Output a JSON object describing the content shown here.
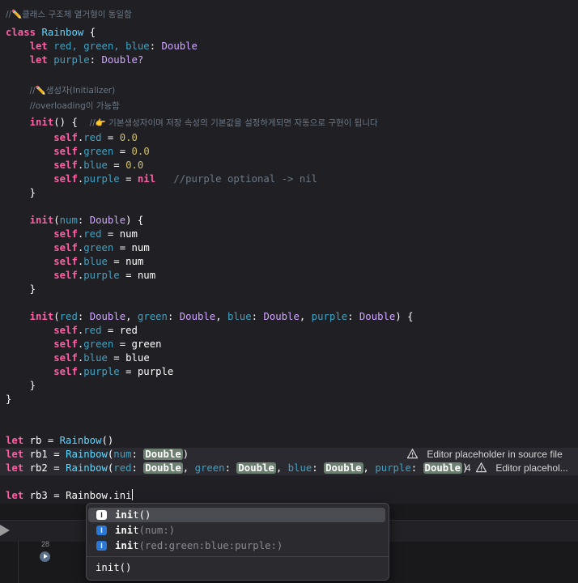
{
  "code": {
    "l1": "//✏️클래스 구조체 열거형이 동일함",
    "l2_kw": "class",
    "l2_name": "Rainbow",
    "l2_brace": " {",
    "l3_kw": "let",
    "l3_vars": "red, green, blue",
    "l3_type": "Double",
    "l4_kw": "let",
    "l4_var": "purple",
    "l4_type": "Double?",
    "l6": "//✏️생성자(Initializer)",
    "l7": "//overloading이 가능함",
    "l8_kw": "init",
    "l8_sig": "() {  ",
    "l8_cm": "//👉 기본생성자이며 저장 속성의 기본값을 설정하게되면 자동으로 구현이 됩니다",
    "self": "self",
    "red": "red",
    "green": "green",
    "blue": "blue",
    "purple": "purple",
    "zero": "0.0",
    "nil": "nil",
    "purple_cm": "//purple optional -> nil",
    "num": "num",
    "Double": "Double",
    "let": "let",
    "init": "init",
    "rb": "rb",
    "rb1": "rb1",
    "rb2": "rb2",
    "rb3": "rb3",
    "Rainbow": "Rainbow",
    "typed": "Rainbow.ini"
  },
  "warnings": {
    "w1": "Editor placeholder in source file",
    "w2_count": "4",
    "w2": "Editor placehol..."
  },
  "debug": {
    "line_number": "28"
  },
  "autocomplete": {
    "badge": "I",
    "items": [
      {
        "match": "ini",
        "rest": "t()",
        "params": ""
      },
      {
        "match": "ini",
        "rest": "t",
        "params": "(num:)"
      },
      {
        "match": "ini",
        "rest": "t",
        "params": "(red:green:blue:purple:)"
      }
    ],
    "detail": "init()"
  },
  "colors": {
    "background": "#1f1f24",
    "keyword": "#fc5fa3",
    "type": "#d0a8ff",
    "class_name": "#5dd8ff",
    "property": "#41a1c0",
    "number": "#d0bf69",
    "comment": "#6c7986",
    "placeholder": "#6c7f70",
    "autocomplete_badge": "#2a77d6"
  }
}
